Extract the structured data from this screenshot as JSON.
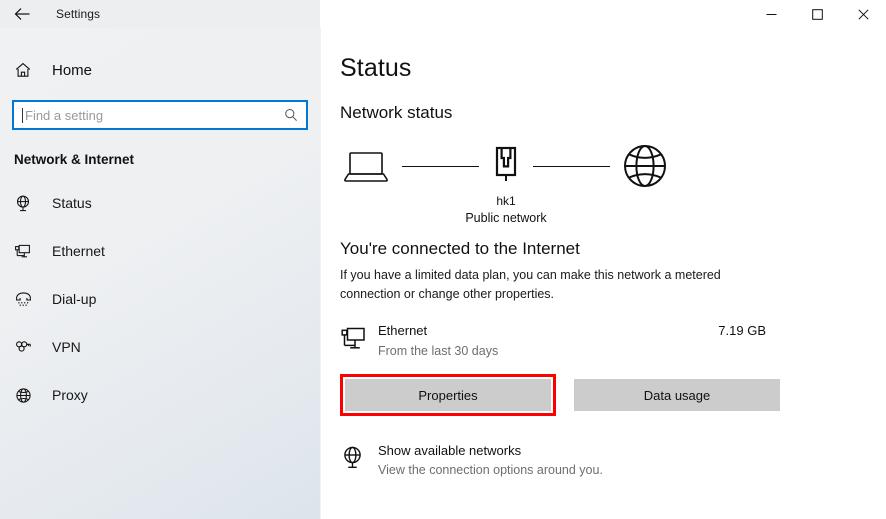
{
  "window": {
    "title": "Settings",
    "back_icon": "back-arrow-icon",
    "controls": {
      "minimize": "—",
      "maximize": "□",
      "close": "✕"
    }
  },
  "sidebar": {
    "home": {
      "label": "Home",
      "icon": "home-icon"
    },
    "search": {
      "value": "",
      "placeholder": "Find a setting",
      "icon": "search-icon"
    },
    "section_title": "Network & Internet",
    "items": [
      {
        "label": "Status",
        "icon": "globe-status-icon",
        "selected": true
      },
      {
        "label": "Ethernet",
        "icon": "ethernet-icon",
        "selected": false
      },
      {
        "label": "Dial-up",
        "icon": "phone-icon",
        "selected": false
      },
      {
        "label": "VPN",
        "icon": "vpn-key-icon",
        "selected": false
      },
      {
        "label": "Proxy",
        "icon": "globe-icon",
        "selected": false
      }
    ]
  },
  "main": {
    "page_title": "Status",
    "network_status_heading": "Network status",
    "diagram": {
      "device_icon": "laptop-icon",
      "network_icon": "ethernet-port-icon",
      "internet_icon": "globe-icon",
      "network_name": "hk1",
      "network_type": "Public network"
    },
    "connected_heading": "You're connected to the Internet",
    "connected_description": "If you have a limited data plan, you can make this network a metered connection or change other properties.",
    "connection": {
      "icon": "ethernet-monitor-icon",
      "name": "Ethernet",
      "subtitle": "From the last 30 days",
      "usage": "7.19 GB"
    },
    "buttons": {
      "properties": "Properties",
      "data_usage": "Data usage"
    },
    "show_networks": {
      "icon": "globe-status-icon",
      "title": "Show available networks",
      "subtitle": "View the connection options around you."
    }
  },
  "colors": {
    "accent": "#0078d4",
    "highlight_box": "#fe0000",
    "button_bg": "#cccccc",
    "sidebar_bg": "#eef0f2",
    "text": "#111111",
    "muted_text": "#6e6e6e"
  }
}
